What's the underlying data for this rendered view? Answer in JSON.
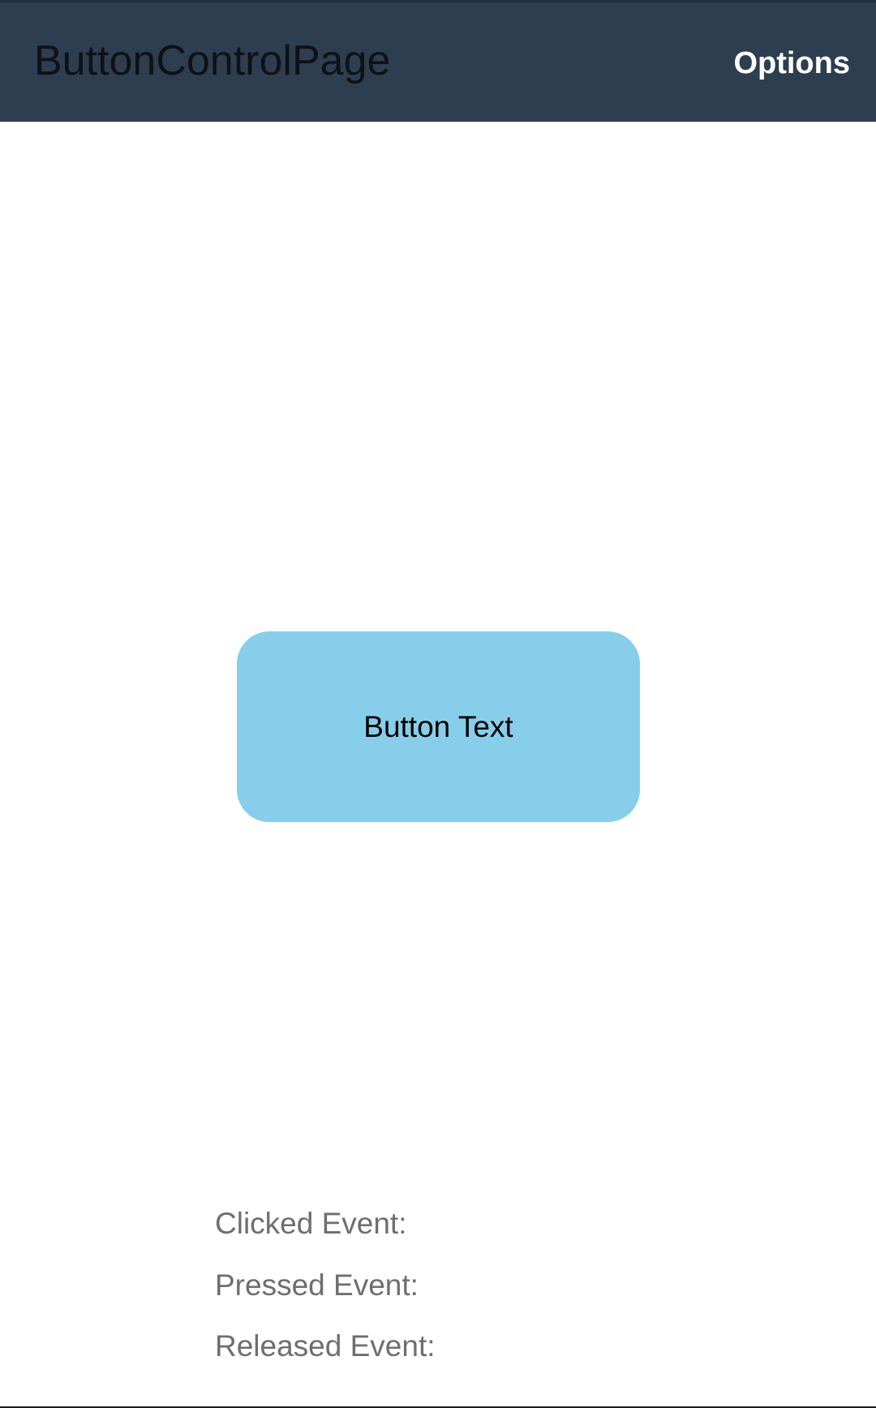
{
  "app_bar": {
    "title": "ButtonControlPage",
    "options_label": "Options",
    "background_color": "#2d3e50"
  },
  "main": {
    "button_label": "Button Text",
    "button_color": "#87ceeb"
  },
  "events": {
    "clicked_label": "Clicked Event:",
    "pressed_label": "Pressed Event:",
    "released_label": "Released Event:"
  }
}
